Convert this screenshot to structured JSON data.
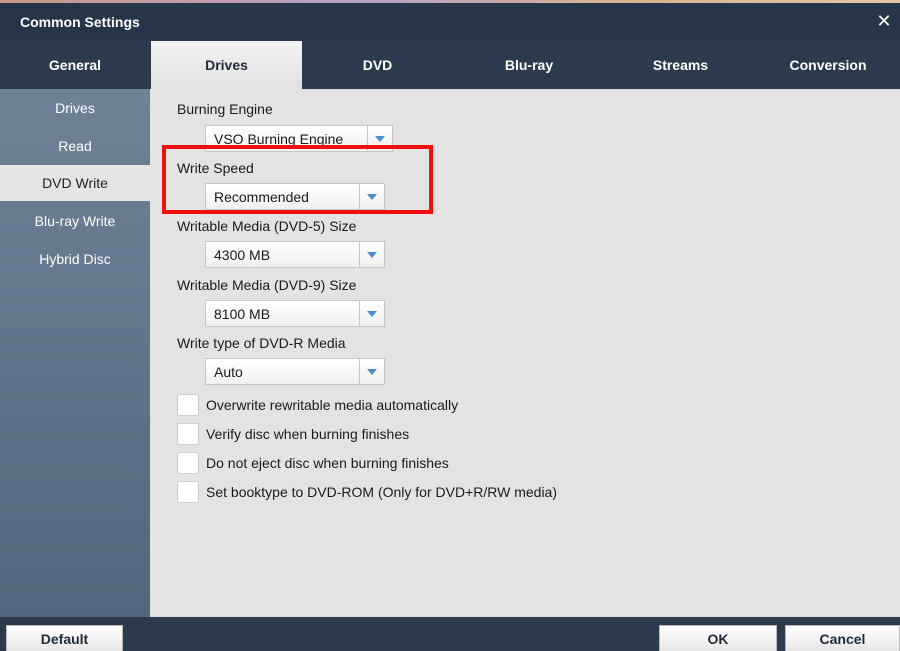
{
  "window": {
    "title": "Common Settings",
    "close_glyph": "✕"
  },
  "tabs": [
    {
      "label": "General"
    },
    {
      "label": "Drives"
    },
    {
      "label": "DVD"
    },
    {
      "label": "Blu-ray"
    },
    {
      "label": "Streams"
    },
    {
      "label": "Conversion"
    }
  ],
  "active_tab": "Drives",
  "sidebar": {
    "items": [
      {
        "label": "Drives"
      },
      {
        "label": "Read"
      },
      {
        "label": "DVD Write"
      },
      {
        "label": "Blu-ray Write"
      },
      {
        "label": "Hybrid Disc"
      }
    ],
    "active": "DVD Write"
  },
  "settings": {
    "burning_engine": {
      "label": "Burning Engine",
      "value": "VSO Burning Engine"
    },
    "write_speed": {
      "label": "Write Speed",
      "value": "Recommended"
    },
    "dvd5_size": {
      "label": "Writable Media (DVD-5) Size",
      "value": "4300 MB"
    },
    "dvd9_size": {
      "label": "Writable Media (DVD-9) Size",
      "value": "8100 MB"
    },
    "dvdr_write_type": {
      "label": "Write type of DVD-R Media",
      "value": "Auto"
    }
  },
  "checkboxes": [
    {
      "label": "Overwrite rewritable media automatically",
      "checked": false
    },
    {
      "label": "Verify disc when burning finishes",
      "checked": false
    },
    {
      "label": "Do not eject disc when burning finishes",
      "checked": false
    },
    {
      "label": "Set booktype to DVD-ROM (Only for DVD+R/RW media)",
      "checked": false
    }
  ],
  "footer": {
    "default_label": "Default",
    "ok_label": "OK",
    "cancel_label": "Cancel"
  },
  "colors": {
    "highlight": "#f01010",
    "accent_arrow": "#4a8fd0",
    "title_bar": "#26354a"
  },
  "icons": {
    "close": "close-icon",
    "dropdown": "chevron-down-icon"
  }
}
